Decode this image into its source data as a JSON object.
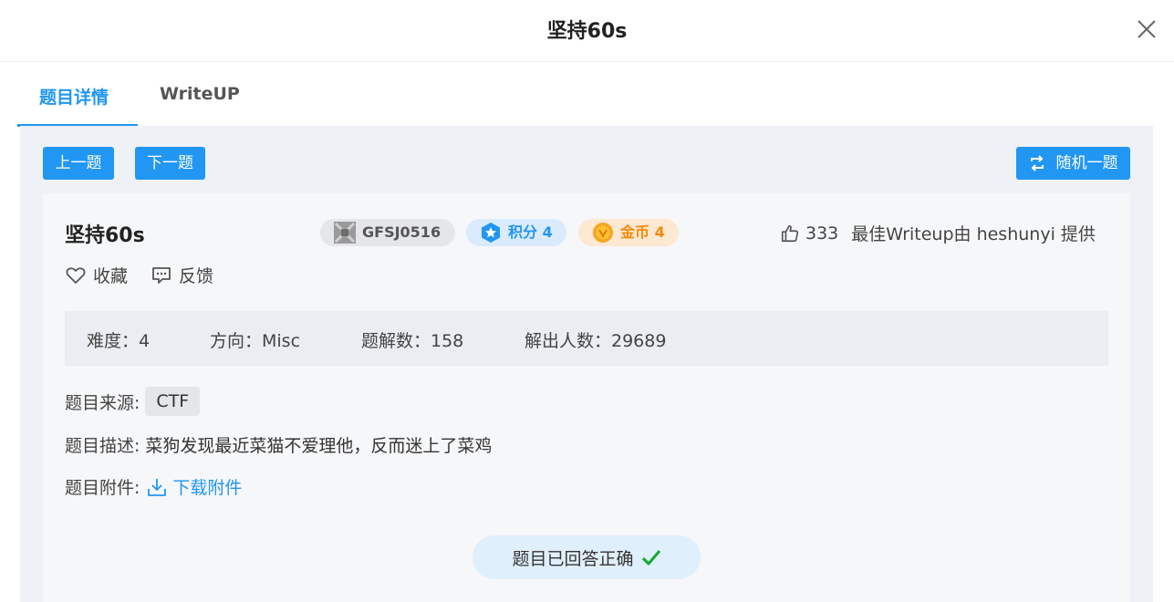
{
  "header": {
    "title": "坚持60s"
  },
  "tabs": [
    {
      "label": "题目详情"
    },
    {
      "label": "WriteUP"
    }
  ],
  "toolbar": {
    "prev_label": "上一题",
    "next_label": "下一题",
    "random_label": "随机一题"
  },
  "challenge": {
    "title": "坚持60s",
    "id": "GFSJ0516",
    "score_label": "积分 4",
    "coin_label": "金币 4",
    "likes": "333",
    "best_writeup": "最佳Writeup由 heshunyi 提供",
    "favorite_label": "收藏",
    "feedback_label": "反馈",
    "stats": {
      "difficulty": "难度：4",
      "direction": "方向：Misc",
      "writeups": "题解数：158",
      "solvers": "解出人数：29689"
    },
    "source_label": "题目来源:",
    "source_value": "CTF",
    "desc_label": "题目描述:",
    "desc_value": "菜狗发现最近菜猫不爱理他，反而迷上了菜鸡",
    "attachment_label": "题目附件:",
    "attachment_link": "下载附件",
    "status": "题目已回答正确"
  },
  "colors": {
    "accent": "#2196f3",
    "coin": "#f28a0b",
    "success": "#1aaa3a"
  }
}
